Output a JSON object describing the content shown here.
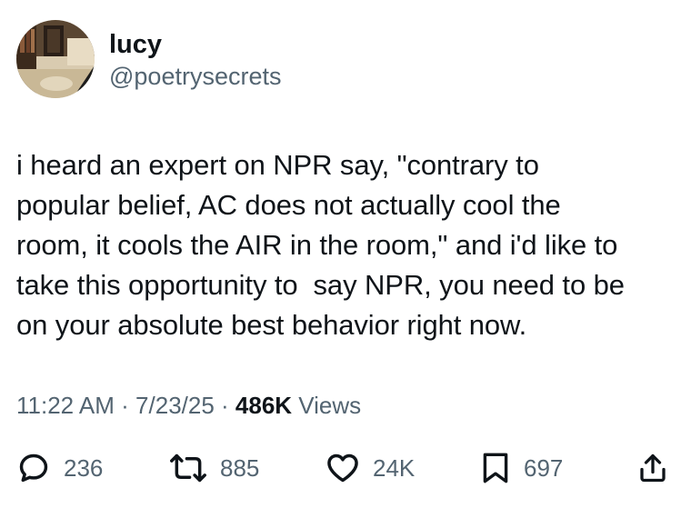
{
  "author": {
    "name": "lucy",
    "handle": "@poetrysecrets"
  },
  "tweet": {
    "text": "i heard an expert on NPR say, \"contrary to\npopular belief, AC does not actually cool the\nroom, it cools the AIR in the room,\" and i'd like to\ntake this opportunity to  say NPR, you need to be\non your absolute best behavior right now."
  },
  "meta": {
    "time": "11:22 AM",
    "sep1": " · ",
    "date": "7/23/25",
    "sep2": " · ",
    "views_count": "486K",
    "views_label": " Views"
  },
  "actions": {
    "replies": "236",
    "reposts": "885",
    "likes": "24K",
    "bookmarks": "697"
  },
  "colors": {
    "text": "#0f1419",
    "secondary": "#536471"
  },
  "icons": {
    "reply": "reply-icon",
    "repost": "repost-icon",
    "like": "heart-icon",
    "bookmark": "bookmark-icon",
    "share": "share-icon"
  }
}
